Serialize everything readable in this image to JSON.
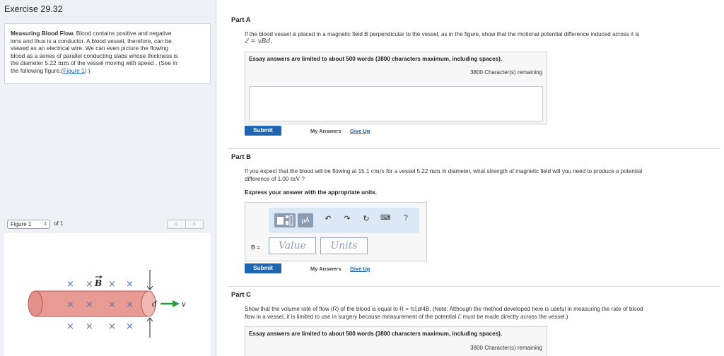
{
  "exercise": {
    "title": "Exercise 29.32"
  },
  "problem": {
    "heading": "Measuring Blood Flow.",
    "line1_rest": " Blood contains positive and negative",
    "line2": "ions and thus is a conductor. A blood vessel, therefore, can be",
    "line3": "viewed as an electrical wire. We can even picture the flowing",
    "line4": "blood as a series of parallel conducting slabs whose thickness is",
    "line5_a": "the diameter 5.22 ",
    "line5_unit": "mm",
    "line5_b": " of the vessel moving with speed . (See in",
    "line6_a": "the following figure.(",
    "figure_link": "Figure 1",
    "line6_b": ") )"
  },
  "figure_nav": {
    "select_value": "Figure 1",
    "of_text": "of 1",
    "prev": "<",
    "next": ">"
  },
  "figure": {
    "b_label": "B",
    "d_label": "d",
    "v_label": "v",
    "cross": "×"
  },
  "partA": {
    "label": "Part A",
    "q_line1": "If the blood vessel is placed in a magnetic field B perpendicular to the vessel, as in the figure, show that the motional potential difference induced across it is",
    "q_line2": "ℰ = vBd.",
    "limit": "Essay answers are limited to about 500 words (3800 characters maximum, including spaces).",
    "remaining": "3800 Character(s) remaining",
    "submit": "Submit",
    "my_answers": "My Answers",
    "give_up": "Give Up"
  },
  "partB": {
    "label": "Part B",
    "q_line1_a": "If you expect that the blood will be flowing at 15.1 ",
    "q_line1_u1": "cm/s",
    "q_line1_b": " for a vessel 5.22 ",
    "q_line1_u2": "mm",
    "q_line1_c": " in diameter, what strength of magnetic field will you need to produce a potential",
    "q_line2_a": "difference of 1.00 ",
    "q_line2_u": "mV",
    "q_line2_b": " ?",
    "instruction": "Express your answer with the appropriate units.",
    "toolbar": {
      "mu_a": "μÅ",
      "undo": "↶",
      "redo": "↷",
      "reset": "↻",
      "keyboard": "⌨",
      "help": "?"
    },
    "b_eq": "B =",
    "value_placeholder": "Value",
    "units_placeholder": "Units",
    "submit": "Submit",
    "my_answers": "My Answers",
    "give_up": "Give Up"
  },
  "partC": {
    "label": "Part C",
    "q_line1": "Show that the volume rate of flow (R) of the blood is equal to R = πℰd/4B. (Note: Although the method developed here is useful in measuring the rate of blood",
    "q_line2": "flow in a vessel, it is limited to use in surgery because measurement of the potential ℰ must be made directly across the vessel.)",
    "limit": "Essay answers are limited to about 500 words (3800 characters maximum, including spaces).",
    "remaining": "3800 Character(s) remaining"
  },
  "colors": {
    "accent": "#1f66b2",
    "toolbar_bg": "#dbe8f6",
    "vessel": "#e89a94",
    "arrow_green": "#2e9a3a"
  }
}
